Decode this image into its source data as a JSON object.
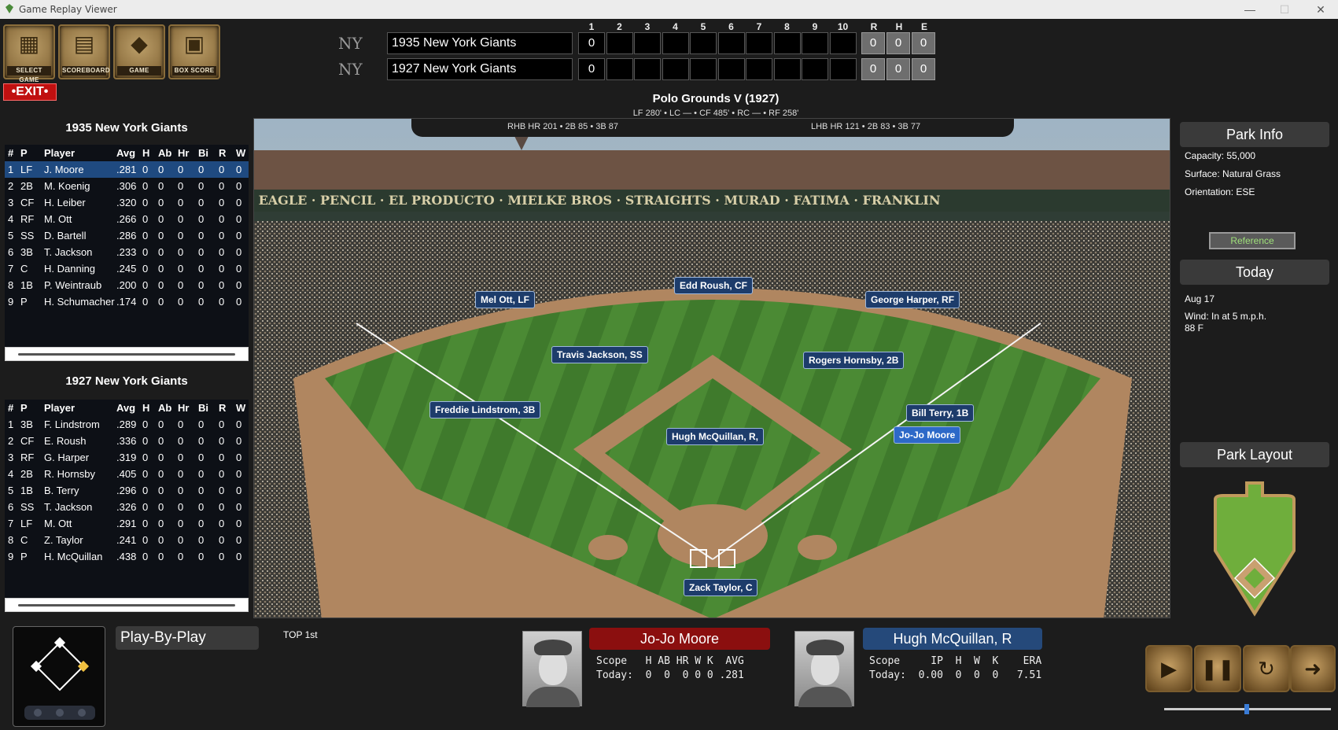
{
  "window": {
    "title": "Game Replay Viewer",
    "min": "—",
    "max": "☐",
    "close": "✕"
  },
  "toolbar": {
    "select_game": "SELECT GAME",
    "scoreboard": "SCOREBOARD",
    "game": "GAME",
    "box_score": "BOX SCORE",
    "exit": "•EXIT•"
  },
  "scoreboard": {
    "innings": [
      "1",
      "2",
      "3",
      "4",
      "5",
      "6",
      "7",
      "8",
      "9",
      "10"
    ],
    "rhe_headers": [
      "R",
      "H",
      "E"
    ],
    "away": {
      "name": "1935 New York Giants",
      "runs_by_inning": [
        "0",
        "",
        "",
        "",
        "",
        "",
        "",
        "",
        "",
        ""
      ],
      "r": "0",
      "h": "0",
      "e": "0"
    },
    "home": {
      "name": "1927 New York Giants",
      "runs_by_inning": [
        "0",
        "",
        "",
        "",
        "",
        "",
        "",
        "",
        "",
        ""
      ],
      "r": "0",
      "h": "0",
      "e": "0"
    }
  },
  "park": {
    "name": "Polo Grounds V (1927)",
    "dims": "LF 280' • LC — • CF 485' • RC — • RF 258'",
    "rhb": "RHB   HR 201 • 2B 85 • 3B 87",
    "lhb": "LHB   HR 121 • 2B 83 • 3B 77"
  },
  "away_roster": {
    "title": "1935 New York Giants",
    "headers": [
      "#",
      "P",
      "Player",
      "Avg",
      "H",
      "Ab",
      "Hr",
      "Bi",
      "R",
      "W"
    ],
    "rows": [
      [
        "1",
        "LF",
        "J. Moore",
        ".281",
        "0",
        "0",
        "0",
        "0",
        "0",
        "0"
      ],
      [
        "2",
        "2B",
        "M. Koenig",
        ".306",
        "0",
        "0",
        "0",
        "0",
        "0",
        "0"
      ],
      [
        "3",
        "CF",
        "H. Leiber",
        ".320",
        "0",
        "0",
        "0",
        "0",
        "0",
        "0"
      ],
      [
        "4",
        "RF",
        "M. Ott",
        ".266",
        "0",
        "0",
        "0",
        "0",
        "0",
        "0"
      ],
      [
        "5",
        "SS",
        "D. Bartell",
        ".286",
        "0",
        "0",
        "0",
        "0",
        "0",
        "0"
      ],
      [
        "6",
        "3B",
        "T. Jackson",
        ".233",
        "0",
        "0",
        "0",
        "0",
        "0",
        "0"
      ],
      [
        "7",
        "C",
        "H. Danning",
        ".245",
        "0",
        "0",
        "0",
        "0",
        "0",
        "0"
      ],
      [
        "8",
        "1B",
        "P. Weintraub",
        ".200",
        "0",
        "0",
        "0",
        "0",
        "0",
        "0"
      ],
      [
        "9",
        "P",
        "H. Schumacher",
        ".174",
        "0",
        "0",
        "0",
        "0",
        "0",
        "0"
      ]
    ]
  },
  "home_roster": {
    "title": "1927 New York Giants",
    "headers": [
      "#",
      "P",
      "Player",
      "Avg",
      "H",
      "Ab",
      "Hr",
      "Bi",
      "R",
      "W"
    ],
    "rows": [
      [
        "1",
        "3B",
        "F. Lindstrom",
        ".289",
        "0",
        "0",
        "0",
        "0",
        "0",
        "0"
      ],
      [
        "2",
        "CF",
        "E. Roush",
        ".336",
        "0",
        "0",
        "0",
        "0",
        "0",
        "0"
      ],
      [
        "3",
        "RF",
        "G. Harper",
        ".319",
        "0",
        "0",
        "0",
        "0",
        "0",
        "0"
      ],
      [
        "4",
        "2B",
        "R. Hornsby",
        ".405",
        "0",
        "0",
        "0",
        "0",
        "0",
        "0"
      ],
      [
        "5",
        "1B",
        "B. Terry",
        ".296",
        "0",
        "0",
        "0",
        "0",
        "0",
        "0"
      ],
      [
        "6",
        "SS",
        "T. Jackson",
        ".326",
        "0",
        "0",
        "0",
        "0",
        "0",
        "0"
      ],
      [
        "7",
        "LF",
        "M. Ott",
        ".291",
        "0",
        "0",
        "0",
        "0",
        "0",
        "0"
      ],
      [
        "8",
        "C",
        "Z. Taylor",
        ".241",
        "0",
        "0",
        "0",
        "0",
        "0",
        "0"
      ],
      [
        "9",
        "P",
        "H. McQuillan",
        ".438",
        "0",
        "0",
        "0",
        "0",
        "0",
        "0"
      ]
    ]
  },
  "fielders": {
    "lf": "Mel Ott, LF",
    "cf": "Edd Roush, CF",
    "rf": "George Harper, RF",
    "ss": "Travis Jackson, SS",
    "b2": "Rogers Hornsby, 2B",
    "b3": "Freddie Lindstrom, 3B",
    "b1": "Bill Terry, 1B",
    "runner": "Jo-Jo Moore",
    "p": "Hugh McQuillan, R,",
    "c": "Zack Taylor, C"
  },
  "park_info": {
    "title": "Park Info",
    "capacity": "Capacity: 55,000",
    "surface": "Surface: Natural Grass",
    "orientation": "Orientation: ESE",
    "reference": "Reference"
  },
  "today": {
    "title": "Today",
    "date": "Aug 17",
    "wind": "Wind: In at 5 m.p.h.",
    "temp": "88  F"
  },
  "park_layout": {
    "title": "Park Layout"
  },
  "play": {
    "title": "Play-By-Play",
    "inning": "TOP 1st"
  },
  "batter": {
    "name": "Jo-Jo Moore",
    "header": "Scope   H AB HR W K  AVG",
    "today": "Today:  0  0  0 0 0 .281"
  },
  "pitcher": {
    "name": "Hugh McQuillan, R",
    "header": "Scope     IP  H  W  K    ERA",
    "today": "Today:  0.00  0  0  0   7.51"
  },
  "colors": {
    "batter_bar": "#8b0f0f",
    "pitcher_bar": "#25497a",
    "runner_label": "#2d69c8",
    "fielder_label": "#1d3c6b"
  }
}
